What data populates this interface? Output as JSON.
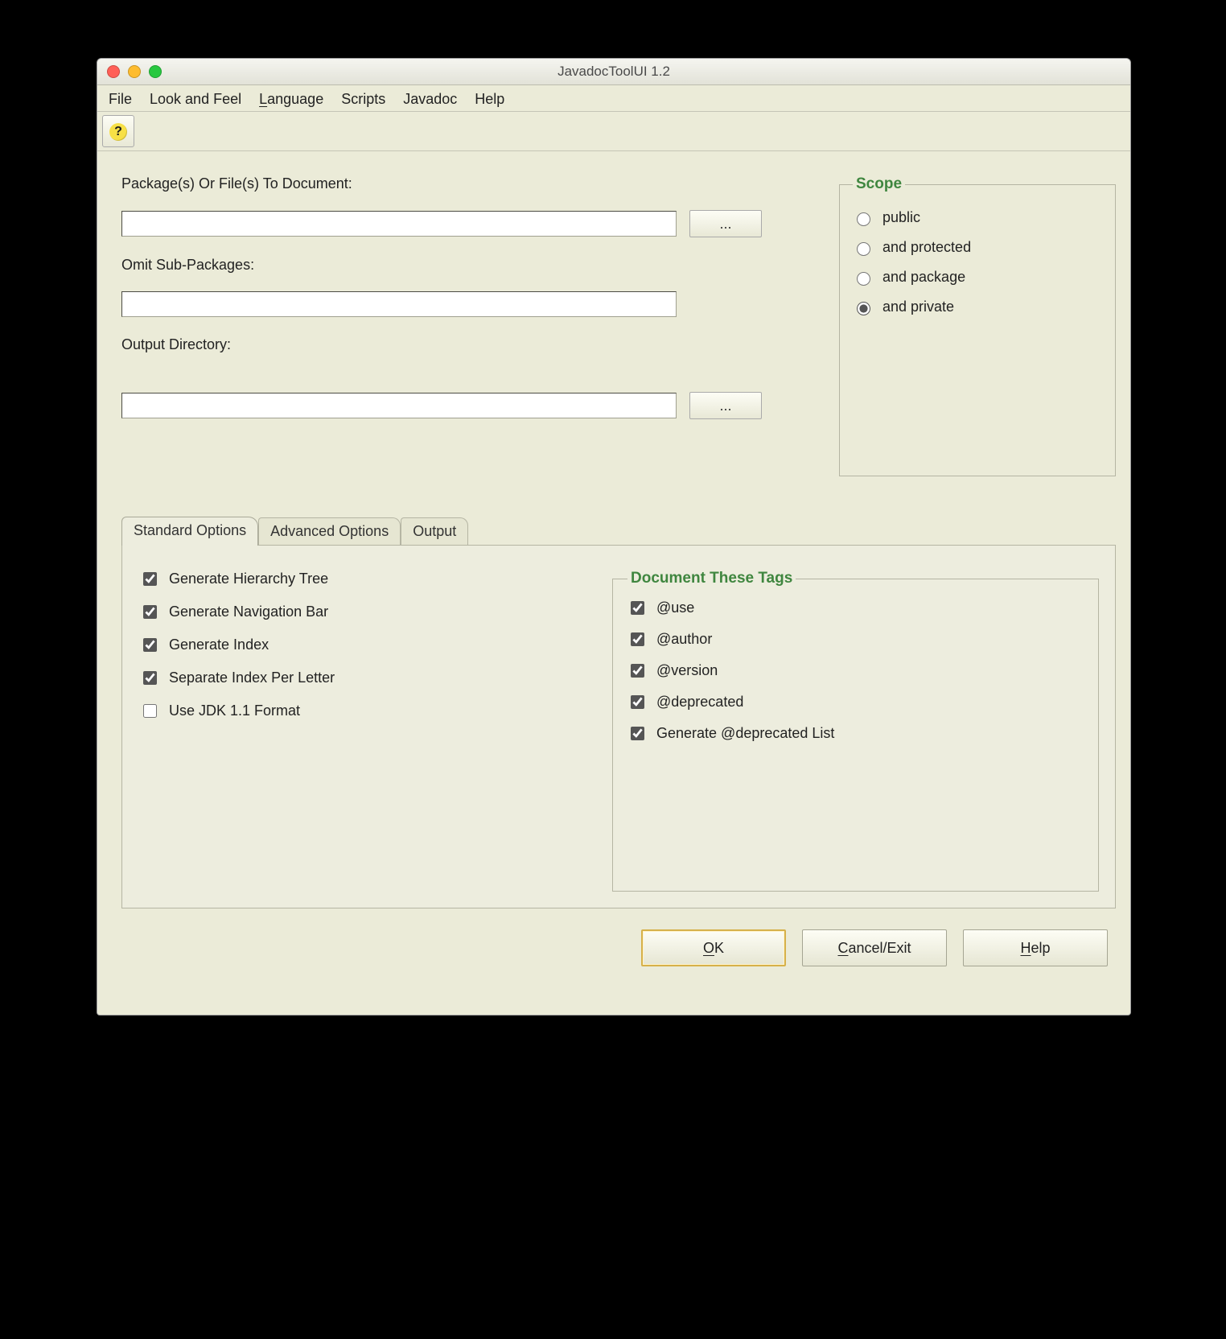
{
  "window": {
    "title": "JavadocToolUI 1.2"
  },
  "menus": {
    "file": "File",
    "look_and_feel": "Look and Feel",
    "language_pre": "L",
    "language_rest": "anguage",
    "scripts": "Scripts",
    "javadoc": "Javadoc",
    "help": "Help"
  },
  "form": {
    "packages_label": "Package(s) Or File(s) To Document:",
    "packages_value": "",
    "omit_label": "Omit Sub-Packages:",
    "omit_value": "",
    "output_label": "Output Directory:",
    "output_value": "",
    "browse_label": "..."
  },
  "scope": {
    "legend": "Scope",
    "options": {
      "public": "public",
      "protected": "and protected",
      "package": "and package",
      "private": "and private"
    },
    "selected": "private"
  },
  "tabs": {
    "standard": "Standard Options",
    "advanced": "Advanced Options",
    "output": "Output"
  },
  "standard_options": {
    "hierarchy": "Generate Hierarchy Tree",
    "navbar": "Generate Navigation Bar",
    "index": "Generate Index",
    "sep_index": "Separate Index Per Letter",
    "jdk11": "Use JDK 1.1 Format"
  },
  "standard_checked": {
    "hierarchy": true,
    "navbar": true,
    "index": true,
    "sep_index": true,
    "jdk11": false
  },
  "doc_tags": {
    "legend": "Document These Tags",
    "use": "@use",
    "author": "@author",
    "version": "@version",
    "deprecated": "@deprecated",
    "deprecated_list": "Generate @deprecated List"
  },
  "doc_tags_checked": {
    "use": true,
    "author": true,
    "version": true,
    "deprecated": true,
    "deprecated_list": true
  },
  "buttons": {
    "ok_mn": "O",
    "ok_rest": "K",
    "cancel_pre": "",
    "cancel_mn": "C",
    "cancel_rest": "ancel/Exit",
    "help_mn": "H",
    "help_rest": "elp"
  }
}
